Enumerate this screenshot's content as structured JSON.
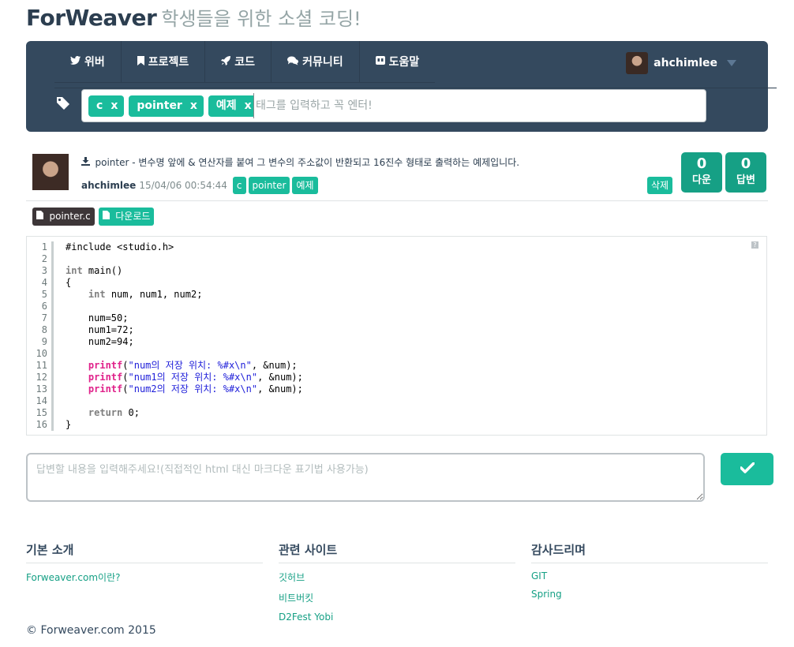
{
  "brand": {
    "name": "ForWeaver",
    "slogan": "학생들을 위한 소셜 코딩!"
  },
  "nav": {
    "items": [
      {
        "icon": "twitter-icon",
        "glyph": "🐦",
        "label": "위버"
      },
      {
        "icon": "bookmark-icon",
        "glyph": "🔖",
        "label": "프로젝트"
      },
      {
        "icon": "rocket-icon",
        "glyph": "🚀",
        "label": "코드"
      },
      {
        "icon": "comments-icon",
        "glyph": "💬",
        "label": "커뮤니티"
      },
      {
        "icon": "gamepad-icon",
        "glyph": "⏺",
        "label": "도움말"
      }
    ],
    "user": "ahchimlee"
  },
  "tags": {
    "chips": [
      "c",
      "pointer",
      "예제"
    ],
    "remove_label": "x",
    "placeholder": "태그를 입력하고 꼭 엔터!"
  },
  "post": {
    "filename": "pointer",
    "description": " - 변수명 앞에 & 연산자를 붙여 그 변수의 주소값이 반환되고 16진수 형태로 출력하는 예제입니다.",
    "author": "ahchimlee",
    "date": "15/04/06 00:54:44",
    "tags": [
      "c",
      "pointer",
      "예제"
    ],
    "delete_label": "삭제",
    "down_count": "0",
    "down_label": "다운",
    "answer_count": "0",
    "answer_label": "답변"
  },
  "files": {
    "file_label": "pointer.c",
    "download_label": "다운로드"
  },
  "code": {
    "line_numbers": [
      "1",
      "2",
      "3",
      "4",
      "5",
      "6",
      "7",
      "8",
      "9",
      "10",
      "11",
      "12",
      "13",
      "14",
      "15",
      "16"
    ],
    "help": "?"
  },
  "answer": {
    "placeholder": "답변할 내용을 입력해주세요!(직접적인 html 대신 마크다운 표기법 사용가능)"
  },
  "footer": {
    "col1": {
      "title": "기본 소개",
      "links": [
        "Forweaver.com이란?"
      ]
    },
    "col2": {
      "title": "관련 사이트",
      "links": [
        "깃허브",
        "비트버킷",
        "D2Fest Yobi"
      ]
    },
    "col3": {
      "title": "감사드리며",
      "links": [
        "GIT",
        "Spring"
      ]
    },
    "copyright": "© Forweaver.com 2015"
  },
  "colors": {
    "navbar": "#34495e",
    "accent": "#1abc9c",
    "accent_dark": "#16a085",
    "file_tab": "#3d3638"
  }
}
